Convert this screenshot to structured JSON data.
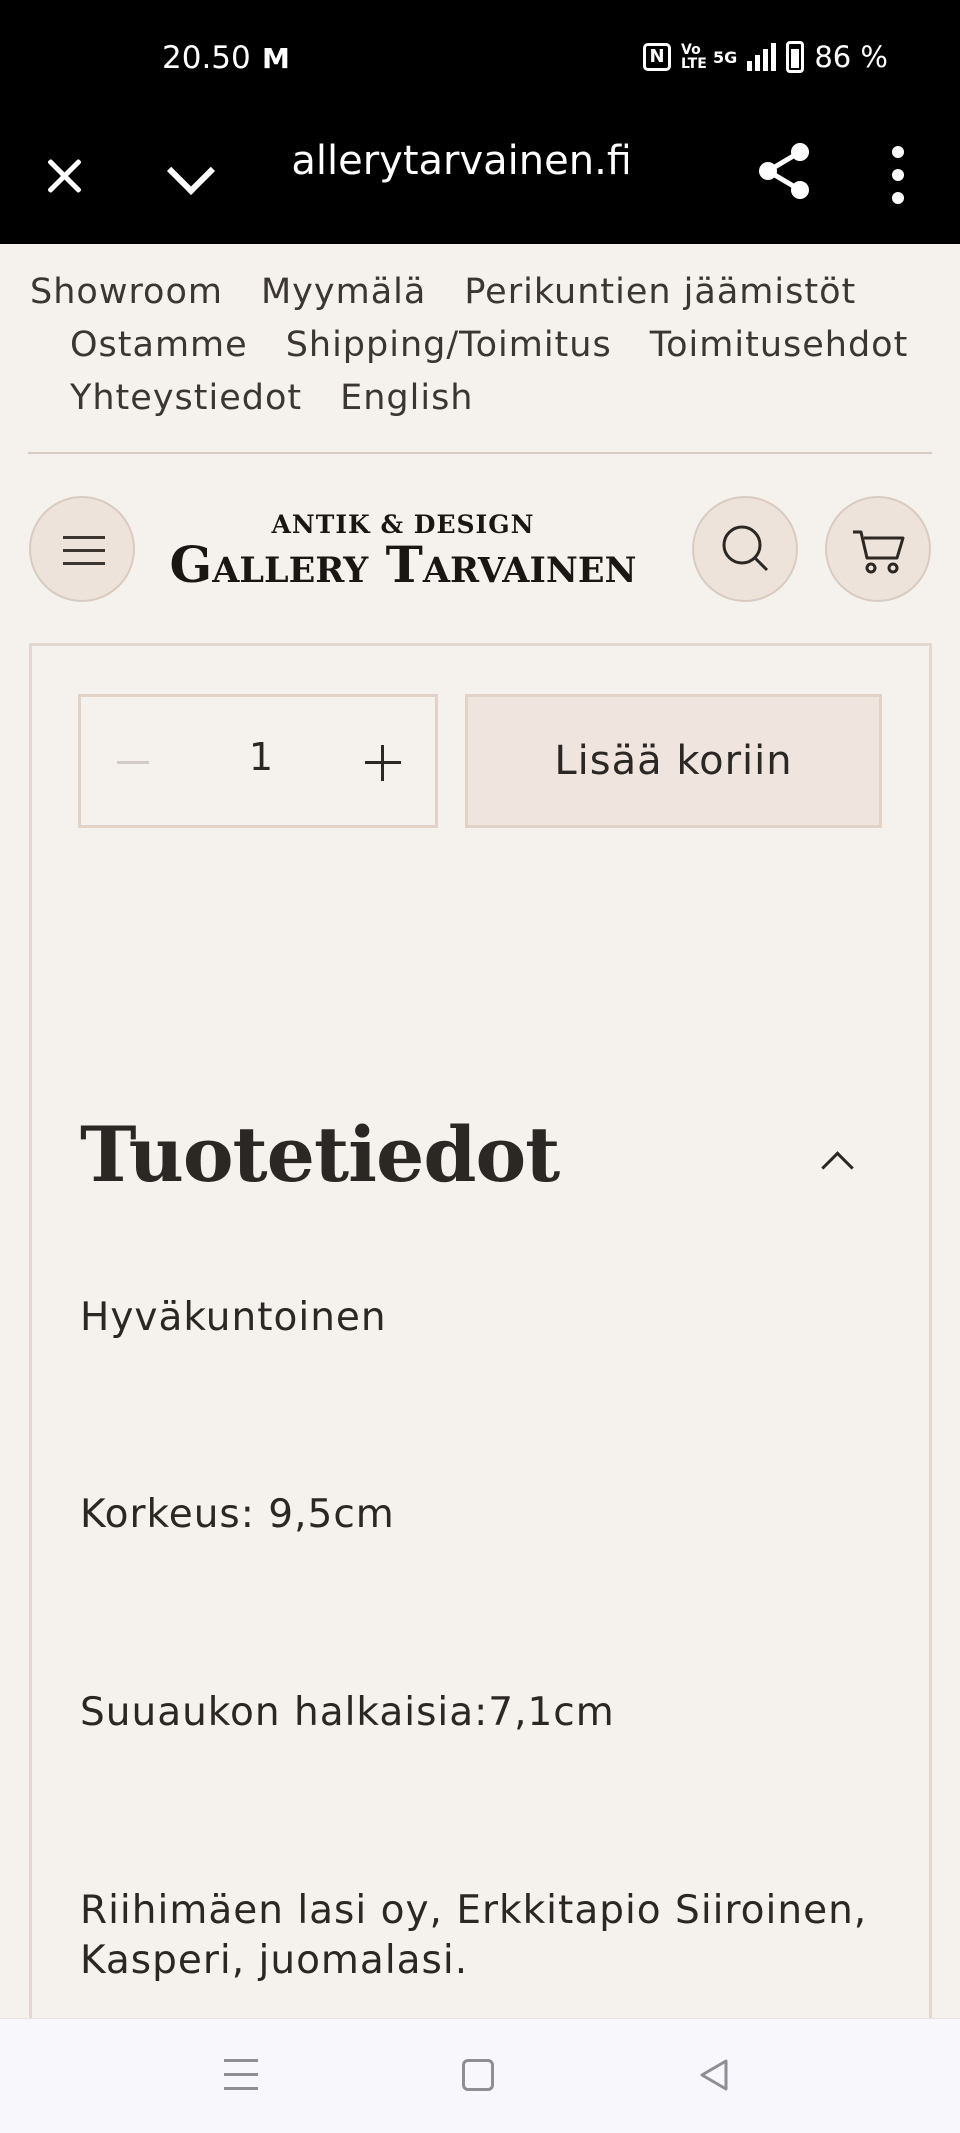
{
  "status_bar": {
    "time": "20.50",
    "mail_icon_label": "M",
    "nfc_label": "N",
    "volte_label": "Vo LTE",
    "network": "5G",
    "battery": "86 %"
  },
  "browser": {
    "url": "gallerytarvainen.fi"
  },
  "top_nav": {
    "items": [
      "Showroom",
      "Myymälä",
      "Perikuntien jäämistöt",
      "Ostamme",
      "Shipping/Toimitus",
      "Toimitusehdot",
      "Yhteystiedot",
      "English"
    ]
  },
  "header": {
    "logo_top": "ANTIK & DESIGN",
    "logo_main": "Gallery Tarvainen"
  },
  "product": {
    "quantity": "1",
    "add_to_cart_label": "Lisää koriin"
  },
  "details": {
    "title": "Tuotetiedot",
    "lines": [
      "Hyväkuntoinen",
      "Korkeus: 9,5cm",
      "Suuaukon halkaisia:7,1cm",
      "Riihimäen lasi oy, Erkkitapio Siiroinen, Kasperi, juomalasi."
    ]
  }
}
